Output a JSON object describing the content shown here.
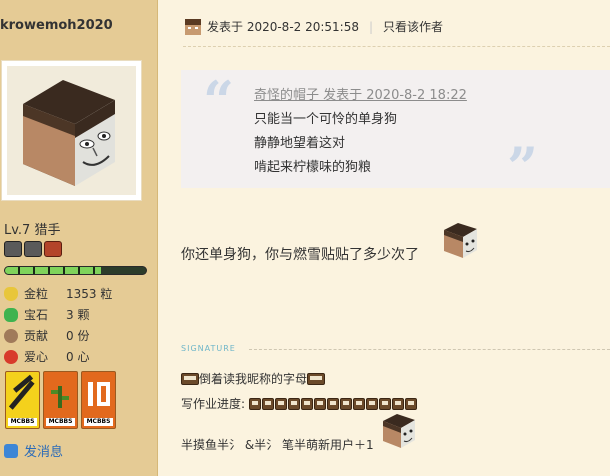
{
  "user": {
    "name": "krowemoh2020",
    "level": "Lv.7 猎手",
    "exp_fraction": 0.68,
    "stats": [
      {
        "label": "金粒",
        "value": "1353 粒",
        "color": "#e8c63a",
        "icon": "gold-nugget-icon"
      },
      {
        "label": "宝石",
        "value": "3 颗",
        "color": "#3fb34f",
        "icon": "emerald-icon"
      },
      {
        "label": "贡献",
        "value": "0 份",
        "color": "#a07a5a",
        "icon": "contribution-icon"
      },
      {
        "label": "爱心",
        "value": "0 心",
        "color": "#d83b2b",
        "icon": "heart-icon"
      }
    ],
    "medal_tag": "MCBBS",
    "send_message": "发消息"
  },
  "post": {
    "posted_at": "发表于 2020-8-2 20:51:58",
    "author_only": "只看该作者",
    "quote": {
      "meta": "奇怪的帽子 发表于 2020-8-2 18:22",
      "lines": [
        "只能当一个可怜的单身狗",
        "静静地望着这对",
        "啃起来柠檬味的狗粮"
      ]
    },
    "text": "你还单身狗，你与燃雪贴贴了多少次了",
    "signature": {
      "label": "SIGNATURE",
      "line1": "倒着读我昵称的字母",
      "line2": "写作业进度:",
      "line3": "半摸鱼半氵 &半氵 笔半萌新用户＋1"
    }
  },
  "colors": {
    "accent_link": "#2b6bb8",
    "sidebar_bg": "#e5cb95",
    "page_bg": "#fbf3df"
  }
}
